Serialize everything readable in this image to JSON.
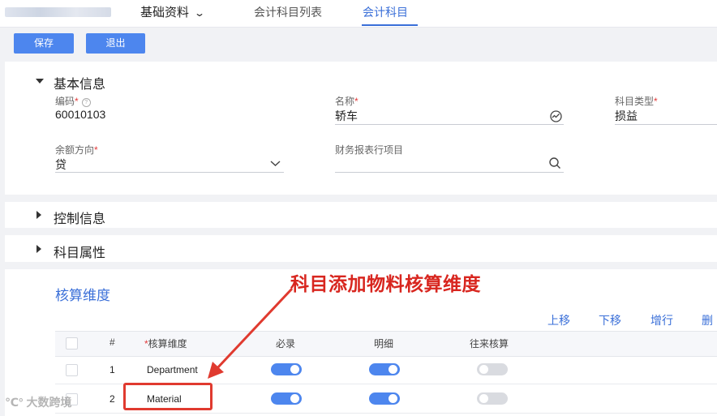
{
  "topbar": {
    "module": "基础资料",
    "tabs": [
      {
        "label": "会计科目列表",
        "active": false
      },
      {
        "label": "会计科目",
        "active": true
      }
    ]
  },
  "toolbar": {
    "save": "保存",
    "exit": "退出"
  },
  "basic_info": {
    "title": "基本信息",
    "fields": {
      "code": {
        "label": "编码",
        "value": "60010103"
      },
      "name": {
        "label": "名称",
        "value": "轿车"
      },
      "type": {
        "label": "科目类型",
        "value": "损益"
      },
      "direction": {
        "label": "余额方向",
        "value": "贷"
      },
      "report_item": {
        "label": "财务报表行项目",
        "value": ""
      }
    }
  },
  "control_info": {
    "title": "控制信息"
  },
  "attributes": {
    "title": "科目属性"
  },
  "dimensions": {
    "title": "核算维度",
    "actions": [
      "上移",
      "下移",
      "增行",
      "删"
    ],
    "columns": [
      "#",
      "核算维度",
      "必录",
      "明细",
      "往来核算"
    ],
    "rows": [
      {
        "index": "1",
        "dimension": "Department",
        "required": true,
        "detail": true,
        "intercompany": false
      },
      {
        "index": "2",
        "dimension": "Material",
        "required": true,
        "detail": true,
        "intercompany": false
      }
    ]
  },
  "annotation": "科目添加物料核算维度",
  "watermark": "大数跨境",
  "colors": {
    "accent": "#4d86ee",
    "annotation": "#d8261f"
  }
}
